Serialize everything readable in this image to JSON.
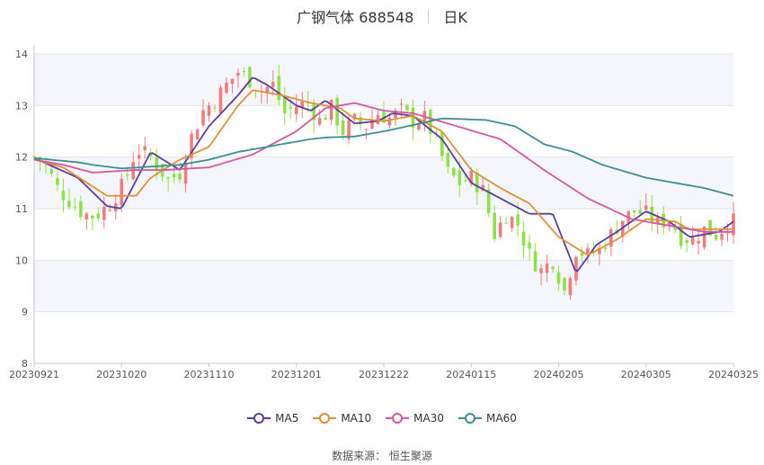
{
  "header": {
    "stock": "广钢气体 688548",
    "period": "日K"
  },
  "source": {
    "label": "数据来源：",
    "name": "恒生聚源"
  },
  "chart_data": {
    "type": "candlestick",
    "title": "广钢气体 688548",
    "ylim": [
      8,
      14
    ],
    "yticks": [
      8,
      9,
      10,
      11,
      12,
      13,
      14
    ],
    "xticks": [
      "20230921",
      "20231020",
      "20231110",
      "20231201",
      "20231222",
      "20240115",
      "20240205",
      "20240305",
      "20240325"
    ],
    "grid": true,
    "legend_position": "bottom",
    "up_color": "#f07c82",
    "down_color": "#8fe04a",
    "series": [
      {
        "name": "MA5",
        "color": "#5b3f9a",
        "keypoints": [
          [
            0,
            11.98
          ],
          [
            1.5,
            11.6
          ],
          [
            2.5,
            11.05
          ],
          [
            3,
            11.0
          ],
          [
            3.5,
            11.55
          ],
          [
            4,
            12.1
          ],
          [
            5,
            11.75
          ],
          [
            6,
            12.6
          ],
          [
            7,
            13.2
          ],
          [
            7.5,
            13.55
          ],
          [
            8,
            13.4
          ],
          [
            9,
            13.0
          ],
          [
            9.5,
            12.9
          ],
          [
            10,
            13.1
          ],
          [
            11,
            12.65
          ],
          [
            11.8,
            12.7
          ],
          [
            12.3,
            12.85
          ],
          [
            13,
            12.8
          ],
          [
            14,
            12.35
          ],
          [
            15,
            11.5
          ],
          [
            16,
            11.2
          ],
          [
            17,
            10.9
          ],
          [
            17.8,
            10.9
          ],
          [
            18.6,
            9.75
          ],
          [
            19.3,
            10.3
          ],
          [
            20,
            10.55
          ],
          [
            21,
            10.95
          ],
          [
            21.8,
            10.75
          ],
          [
            22.5,
            10.45
          ],
          [
            23.5,
            10.55
          ],
          [
            24,
            10.75
          ],
          [
            24.6,
            10.75
          ],
          [
            25,
            10.65
          ]
        ]
      },
      {
        "name": "MA10",
        "color": "#e0913a",
        "keypoints": [
          [
            0,
            11.95
          ],
          [
            1,
            11.8
          ],
          [
            2.5,
            11.25
          ],
          [
            3.5,
            11.25
          ],
          [
            4,
            11.6
          ],
          [
            5,
            11.95
          ],
          [
            6,
            12.2
          ],
          [
            7,
            13.0
          ],
          [
            7.5,
            13.3
          ],
          [
            8.5,
            13.2
          ],
          [
            9.5,
            13.05
          ],
          [
            10.5,
            12.95
          ],
          [
            11,
            12.75
          ],
          [
            12,
            12.7
          ],
          [
            13,
            12.8
          ],
          [
            14,
            12.5
          ],
          [
            15,
            11.75
          ],
          [
            16,
            11.4
          ],
          [
            17,
            11.1
          ],
          [
            18,
            10.45
          ],
          [
            19,
            10.1
          ],
          [
            20,
            10.4
          ],
          [
            21,
            10.8
          ],
          [
            22,
            10.75
          ],
          [
            22.5,
            10.6
          ],
          [
            24,
            10.6
          ],
          [
            25,
            10.7
          ]
        ]
      },
      {
        "name": "MA30",
        "color": "#d259a0",
        "keypoints": [
          [
            0,
            11.95
          ],
          [
            1,
            11.85
          ],
          [
            2,
            11.7
          ],
          [
            3.5,
            11.75
          ],
          [
            4.5,
            11.75
          ],
          [
            6,
            11.8
          ],
          [
            7.5,
            12.05
          ],
          [
            9,
            12.5
          ],
          [
            10,
            12.95
          ],
          [
            11,
            13.05
          ],
          [
            12,
            12.9
          ],
          [
            13,
            12.85
          ],
          [
            14.5,
            12.6
          ],
          [
            16,
            12.35
          ],
          [
            17.5,
            11.75
          ],
          [
            19,
            11.2
          ],
          [
            20.5,
            10.8
          ],
          [
            22,
            10.65
          ],
          [
            23,
            10.55
          ],
          [
            25,
            10.55
          ]
        ]
      },
      {
        "name": "MA60",
        "color": "#3c8f94",
        "keypoints": [
          [
            0,
            11.98
          ],
          [
            1.5,
            11.9
          ],
          [
            2,
            11.85
          ],
          [
            3,
            11.78
          ],
          [
            5,
            11.85
          ],
          [
            6,
            11.95
          ],
          [
            7,
            12.1
          ],
          [
            8.5,
            12.25
          ],
          [
            9.5,
            12.35
          ],
          [
            10,
            12.38
          ],
          [
            11,
            12.4
          ],
          [
            12,
            12.5
          ],
          [
            13,
            12.62
          ],
          [
            14,
            12.75
          ],
          [
            15.5,
            12.72
          ],
          [
            16.5,
            12.6
          ],
          [
            17.5,
            12.25
          ],
          [
            18.5,
            12.1
          ],
          [
            19.5,
            11.85
          ],
          [
            21,
            11.6
          ],
          [
            23,
            11.4
          ],
          [
            25,
            11.1
          ]
        ]
      }
    ],
    "price_path": [
      [
        0,
        12.0
      ],
      [
        0.3,
        11.95
      ],
      [
        0.8,
        11.4
      ],
      [
        1.3,
        11.1
      ],
      [
        1.7,
        10.9
      ],
      [
        2.1,
        10.85
      ],
      [
        2.6,
        11.1
      ],
      [
        3.1,
        11.5
      ],
      [
        3.5,
        12.15
      ],
      [
        4.0,
        12.0
      ],
      [
        4.6,
        11.55
      ],
      [
        5.0,
        11.7
      ],
      [
        5.4,
        12.4
      ],
      [
        5.8,
        12.9
      ],
      [
        6.2,
        13.1
      ],
      [
        6.6,
        13.4
      ],
      [
        7.0,
        13.65
      ],
      [
        7.4,
        13.5
      ],
      [
        7.8,
        13.3
      ],
      [
        8.2,
        13.4
      ],
      [
        8.6,
        12.85
      ],
      [
        9.0,
        13.0
      ],
      [
        9.4,
        13.05
      ],
      [
        9.8,
        12.7
      ],
      [
        10.2,
        12.95
      ],
      [
        10.6,
        12.5
      ],
      [
        11.0,
        12.7
      ],
      [
        11.4,
        12.6
      ],
      [
        11.8,
        12.85
      ],
      [
        12.2,
        12.75
      ],
      [
        12.6,
        12.9
      ],
      [
        13.0,
        12.7
      ],
      [
        13.4,
        12.75
      ],
      [
        13.8,
        12.3
      ],
      [
        14.2,
        11.7
      ],
      [
        14.6,
        11.5
      ],
      [
        15.0,
        11.6
      ],
      [
        15.4,
        11.35
      ],
      [
        15.8,
        10.5
      ],
      [
        16.2,
        10.9
      ],
      [
        16.6,
        10.7
      ],
      [
        17.0,
        10.1
      ],
      [
        17.4,
        9.8
      ],
      [
        17.8,
        10.0
      ],
      [
        18.2,
        9.4
      ],
      [
        18.6,
        10.2
      ],
      [
        19.0,
        10.1
      ],
      [
        19.4,
        10.2
      ],
      [
        19.8,
        10.5
      ],
      [
        20.2,
        10.8
      ],
      [
        20.6,
        10.95
      ],
      [
        21.0,
        10.9
      ],
      [
        21.4,
        10.7
      ],
      [
        21.8,
        10.8
      ],
      [
        22.2,
        10.45
      ],
      [
        22.6,
        10.4
      ],
      [
        23.0,
        10.6
      ],
      [
        23.4,
        10.5
      ],
      [
        23.8,
        10.7
      ],
      [
        24.2,
        10.8
      ],
      [
        24.6,
        10.7
      ],
      [
        25.0,
        10.55
      ]
    ]
  }
}
